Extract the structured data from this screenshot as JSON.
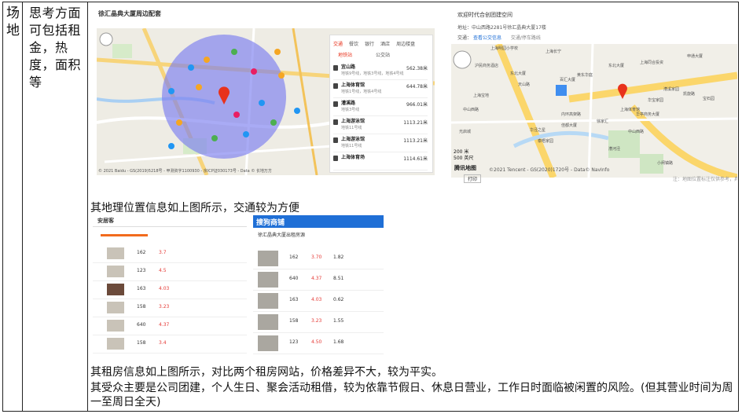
{
  "left_col": {
    "venue": "场地",
    "considerations": "思考方面可包括租金，热度，面积等"
  },
  "map1": {
    "title": "徐汇晶典大厦周边配套",
    "tabs": [
      "交通",
      "餐饮",
      "银行",
      "酒店",
      "周边楼盘"
    ],
    "subtabs": [
      "地铁站",
      "公交站"
    ],
    "stations": [
      {
        "name": "宜山路",
        "lines": "地铁9号线，地铁3号线，地铁4号线",
        "dist": "562.38米"
      },
      {
        "name": "上海体育馆",
        "lines": "地铁1号线，地铁4号线",
        "dist": "644.78米"
      },
      {
        "name": "漕溪路",
        "lines": "地铁3号线",
        "dist": "966.01米"
      },
      {
        "name": "上海游泳馆",
        "lines": "地铁11号线",
        "dist": "1113.21米"
      },
      {
        "name": "上海游泳馆",
        "lines": "地铁11号线",
        "dist": "1113.21米"
      },
      {
        "name": "上海体育场",
        "lines": "",
        "dist": "1114.61米"
      }
    ],
    "copyright": "© 2021 Baidu - GS(2019)5218号 - 甲测资字1100930 - 京ICP证030173号 - Data © 长地万方"
  },
  "map2": {
    "title": "欢迎时代合创团建空间",
    "address": "地址：中山西路2281号徐汇晶典大厦17楼",
    "transit_label": "交通：",
    "transit_link": "查看公交信息",
    "transit_link2": "交通/停车路线",
    "labels": [
      "上海明园小学校",
      "上海长宁",
      "沪民商务酒店",
      "东北大厦",
      "天山路",
      "百汇大厦",
      "黄东华庭",
      "东北大厦",
      "上海同合投资",
      "漕溪家园",
      "华宝家园",
      "凯旋路",
      "宝石园",
      "申通大厦",
      "上海宝地",
      "中山西路",
      "内环高架路",
      "上海体育馆",
      "华亭商务大厦",
      "徐家汇",
      "华泾之星",
      "泰晤家园",
      "漕河泾",
      "小闸镇路",
      "光启城",
      "佳都大厦",
      "中山西路"
    ],
    "scale_top": "200 米",
    "scale_bottom": "500 英尺",
    "brand": "腾讯地图",
    "copyright": "©2021 Tencent - GS(2020)1720号 - Data© NavInfo",
    "print": "打印",
    "note": "注：地图位置标注仅供参考，具"
  },
  "caption1": "其地理位置信息如上图所示，交通较为方便",
  "rent1": {
    "logo": "安居客",
    "rows": [
      {
        "area": "162",
        "price": "3.7"
      },
      {
        "area": "123",
        "price": "4.5"
      },
      {
        "area": "163",
        "price": "4.03"
      },
      {
        "area": "158",
        "price": "3.23"
      },
      {
        "area": "640",
        "price": "4.37"
      },
      {
        "area": "158",
        "price": "3.4"
      }
    ]
  },
  "rent2": {
    "logo": "搜狗商铺",
    "subtitle": "徐汇晶典大厦出租房源",
    "rows": [
      {
        "area": "162",
        "price": "3.70",
        "total": "1.82"
      },
      {
        "area": "640",
        "price": "4.37",
        "total": "8.51"
      },
      {
        "area": "163",
        "price": "4.03",
        "total": "0.62"
      },
      {
        "area": "158",
        "price": "3.23",
        "total": "1.55"
      },
      {
        "area": "123",
        "price": "4.50",
        "total": "1.68"
      }
    ]
  },
  "caption2": "其租房信息如上图所示，对比两个租房网站，价格差异不大，较为平实。",
  "caption3_line1": "其受众主要是公司团建，个人生日、聚会活动租借，较为依靠节假日、休息日营业，工作日时面临被闲置的风险。(但其营业时间为周",
  "caption3_line2": "一至周日全天)",
  "colors": {
    "circle": "#7b7ef0",
    "pin": "#e8321c",
    "accent": "#1f6fd6",
    "price_red": "#e53935"
  }
}
